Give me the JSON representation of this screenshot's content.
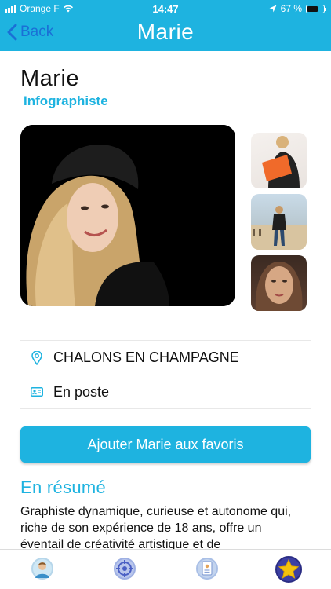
{
  "status_bar": {
    "carrier": "Orange F",
    "time": "14:47",
    "battery": "67 %",
    "battery_level": 0.67
  },
  "nav": {
    "back_label": "Back",
    "title": "Marie"
  },
  "profile": {
    "name": "Marie",
    "role": "Infographiste",
    "location": "CHALONS EN CHAMPAGNE",
    "status": "En poste"
  },
  "actions": {
    "favorite_label": "Ajouter Marie aux favoris"
  },
  "summary": {
    "title": "En résumé",
    "text": "Graphiste dynamique, curieuse et autonome qui, riche de son expérience de 18 ans, offre un éventail de créativité artistique et de"
  },
  "tabs": [
    {
      "icon": "profile-avatar-icon"
    },
    {
      "icon": "target-icon"
    },
    {
      "icon": "document-icon"
    },
    {
      "icon": "star-icon"
    }
  ],
  "colors": {
    "accent": "#1eb3e0",
    "back_link": "#1a6fd6"
  }
}
